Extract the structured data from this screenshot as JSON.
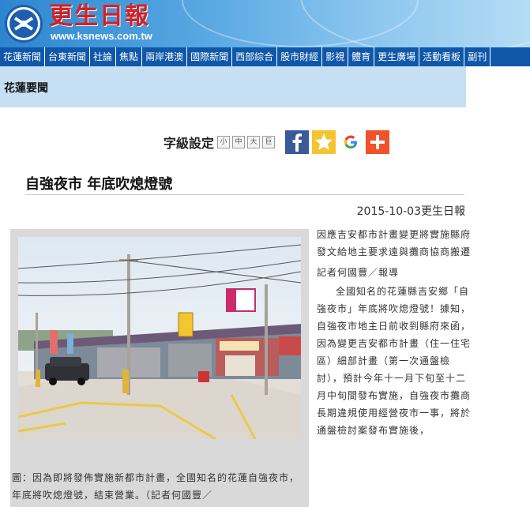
{
  "header": {
    "site_name": "更生日報",
    "site_url": "www.ksnews.com.tw"
  },
  "nav": {
    "items": [
      "花蓮新聞",
      "台東新聞",
      "社論",
      "焦點",
      "兩岸港澳",
      "國際新聞",
      "西部綜合",
      "股市財經",
      "影視",
      "體育",
      "更生廣場",
      "活動看板",
      "副刊"
    ]
  },
  "section": {
    "title": "花蓮要聞"
  },
  "tools": {
    "label": "字級設定",
    "sizes": [
      "小",
      "中",
      "大",
      "巨"
    ],
    "share_icons": [
      "facebook-icon",
      "favorite-star-icon",
      "google-icon",
      "add-plus-icon"
    ]
  },
  "article": {
    "headline": "自強夜市 年底吹熄燈號",
    "date_source": "2015-10-03更生日報",
    "summary": "因應吉安都市計畫變更將實施縣府發文給地主要求遠與攤商協商搬遷",
    "reporter": "記者何國豐／報導",
    "body": "全國知名的花蓮縣吉安鄉「自強夜市」年底將吹熄燈號！據知，自強夜市地主日前收到縣府來函，因為變更吉安都市計畫（住一住宅區）細部計畫（第一次通盤檢討），預計今年十一月下旬至十二月中旬間發布實施，自強夜市攤商長期違規使用經營夜市一事，將於通盤檢討案發布實施後，",
    "caption": "圖：因為即將發佈實施新都市計畫，全國知名的花蓮自強夜市，年底將吹熄燈號，結束營業。（記者何國豐／"
  },
  "colors": {
    "nav_bg": "#0f57a8",
    "section_bg": "#c6dff3",
    "logo_red": "#d91f1f"
  }
}
